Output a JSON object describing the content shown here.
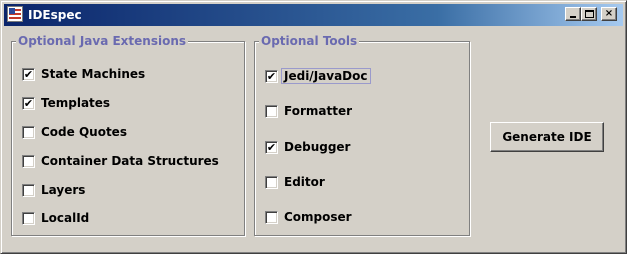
{
  "window": {
    "title": "IDEspec",
    "icon": "flag-icon",
    "controls": {
      "minimize": "minimize-icon",
      "maximize": "maximize-icon",
      "close": "×"
    }
  },
  "java_extensions": {
    "title": "Optional Java Extensions",
    "items": [
      {
        "label": "State Machines",
        "checked": true,
        "mark": "✔"
      },
      {
        "label": "Templates",
        "checked": true,
        "mark": "✔"
      },
      {
        "label": "Code Quotes",
        "checked": false,
        "mark": ""
      },
      {
        "label": "Container Data Structures",
        "checked": false,
        "mark": ""
      },
      {
        "label": "Layers",
        "checked": false,
        "mark": ""
      },
      {
        "label": "LocalId",
        "checked": false,
        "mark": ""
      }
    ]
  },
  "tools": {
    "title": "Optional Tools",
    "items": [
      {
        "label": "Jedi/JavaDoc",
        "checked": true,
        "mark": "✔",
        "focused": true
      },
      {
        "label": "Formatter",
        "checked": false,
        "mark": ""
      },
      {
        "label": "Debugger",
        "checked": true,
        "mark": "✔"
      },
      {
        "label": "Editor",
        "checked": false,
        "mark": ""
      },
      {
        "label": "Composer",
        "checked": false,
        "mark": ""
      }
    ]
  },
  "actions": {
    "generate_label": "Generate IDE"
  },
  "colors": {
    "window_bg": "#d4d0c8",
    "title_start": "#0a246a",
    "title_end": "#a6caf0",
    "group_title": "#6a6ab0"
  }
}
